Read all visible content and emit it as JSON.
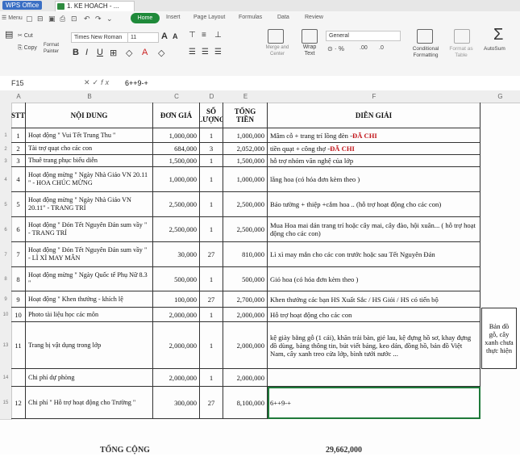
{
  "app": {
    "name": "WPS Office",
    "doc_tab": "1. KE HOACH - ..."
  },
  "tabs": [
    "Menu",
    "Home",
    "Insert",
    "Page Layout",
    "Formulas",
    "Data",
    "Review"
  ],
  "toolbar": {
    "cut": "Cut",
    "copy": "Copy",
    "format_painter": "Format Painter",
    "font_name": "Times New Roman",
    "font_size": "11",
    "merge": "Merge and Center",
    "wrap": "Wrap Text",
    "number_format": "General",
    "conditional": "Conditional Formatting",
    "format_table": "Format as Table",
    "autosum": "AutoSum"
  },
  "formula_bar": {
    "name_box": "F15",
    "formula": "6++9-+"
  },
  "columns": [
    "A",
    "B",
    "C",
    "D",
    "E",
    "F",
    "G"
  ],
  "headers": {
    "stt": "STT",
    "noi_dung": "NỘI DUNG",
    "don_gia": "ĐƠN GIÁ",
    "so_luong": "SỐ LƯỢNG",
    "tong_tien": "TỔNG TIỀN",
    "dien_giai": "DIỄN GIẢI"
  },
  "rows": [
    {
      "rownum": "1",
      "stt": "1",
      "noi_dung": "Hoạt động \" Vui Tết Trung Thu \"",
      "don_gia": "1,000,000",
      "so_luong": "1",
      "tong_tien": "1,000,000",
      "dien_giai": "Mâm cỗ + trang trí lồng đèn -",
      "dien_giai_red": "ĐÃ CHI"
    },
    {
      "rownum": "2",
      "stt": "2",
      "noi_dung": "Tài trợ quạt cho các con",
      "don_gia": "684,000",
      "so_luong": "3",
      "tong_tien": "2,052,000",
      "dien_giai": "tiền quạt + công thợ -",
      "dien_giai_red": "ĐÃ CHI"
    },
    {
      "rownum": "3",
      "stt": "3",
      "noi_dung": "Thuê trang phục biểu diễn",
      "don_gia": "1,500,000",
      "so_luong": "1",
      "tong_tien": "1,500,000",
      "dien_giai": "hỗ trợ nhóm văn nghệ của lớp",
      "dien_giai_red": ""
    },
    {
      "rownum": "4",
      "stt": "4",
      "noi_dung": "Hoạt động mừng \" Ngày Nhà Giáo VN 20.11 \" - HOA CHÚC MỪNG",
      "don_gia": "1,000,000",
      "so_luong": "1",
      "tong_tien": "1,000,000",
      "dien_giai": "lẵng hoa (có hóa đơn kèm theo )",
      "dien_giai_red": ""
    },
    {
      "rownum": "5",
      "stt": "5",
      "noi_dung": "Hoạt động mừng \" Ngày Nhà Giáo VN 20.11\" - TRANG TRÍ",
      "don_gia": "2,500,000",
      "so_luong": "1",
      "tong_tien": "2,500,000",
      "dien_giai": "Báo tường + thiệp +cắm hoa .. (hỗ trợ hoạt động cho các con)",
      "dien_giai_red": ""
    },
    {
      "rownum": "6",
      "stt": "6",
      "noi_dung": "Hoạt động \" Đón Tết Nguyên Đán sum vầy \" - TRANG TRÍ",
      "don_gia": "2,500,000",
      "so_luong": "1",
      "tong_tien": "2,500,000",
      "dien_giai": "Mua Hoa mai dán trang trí hoặc cây mai, cây đào, hội xuân... ( hỗ trợ hoạt động cho các con)",
      "dien_giai_red": ""
    },
    {
      "rownum": "7",
      "stt": "7",
      "noi_dung": "Hoạt động \" Đón Tết Nguyên Đán sum vầy \" - LÌ XÌ MAY MẮN",
      "don_gia": "30,000",
      "so_luong": "27",
      "tong_tien": "810,000",
      "dien_giai": "Lì xì may mắn cho các con trước hoặc sau Tết Nguyên Đán",
      "dien_giai_red": ""
    },
    {
      "rownum": "8",
      "stt": "8",
      "noi_dung": "Hoạt động mừng \" Ngày Quốc tế Phụ Nữ 8.3 \"",
      "don_gia": "500,000",
      "so_luong": "1",
      "tong_tien": "500,000",
      "dien_giai": "Giỏ hoa (có hóa đơn kèm theo )",
      "dien_giai_red": ""
    },
    {
      "rownum": "9",
      "stt": "9",
      "noi_dung": "Hoạt động \" Khen thưởng - khích lệ",
      "don_gia": "100,000",
      "so_luong": "27",
      "tong_tien": "2,700,000",
      "dien_giai": "Khen thưởng các bạn HS Xuất Sắc / HS Giỏi / HS có tiến bộ",
      "dien_giai_red": ""
    },
    {
      "rownum": "10",
      "stt": "10",
      "noi_dung": "Photo tài liệu học các môn",
      "don_gia": "2,000,000",
      "so_luong": "1",
      "tong_tien": "2,000,000",
      "dien_giai": "Hỗ trợ hoạt động cho các con",
      "dien_giai_red": ""
    },
    {
      "rownum": "13",
      "stt": "11",
      "noi_dung": "Trang bị vật dụng trong lớp",
      "don_gia": "2,000,000",
      "so_luong": "1",
      "tong_tien": "2,000,000",
      "dien_giai": "kệ giày bằng gỗ (1 cái), khăn trải bàn, giẻ lau, kệ đựng hồ sơ, khay đựng đồ dùng, bảng thông tin, bút viết bảng, keo dán, đồng hồ, bản đồ Việt Nam, cây xanh treo cửa lớp, bình tưới nước ...",
      "dien_giai_red": ""
    },
    {
      "rownum": "14",
      "stt": "",
      "noi_dung": "Chi phí dự phòng",
      "don_gia": "2,000,000",
      "so_luong": "1",
      "tong_tien": "2,000,000",
      "dien_giai": "",
      "dien_giai_red": ""
    },
    {
      "rownum": "15",
      "stt": "12",
      "noi_dung": "Chi phí \" Hỗ trợ hoạt động cho Trường \"",
      "don_gia": "300,000",
      "so_luong": "27",
      "tong_tien": "8,100,000",
      "dien_giai": "6++9-+",
      "dien_giai_red": ""
    }
  ],
  "side_note": "Bản đồ gỗ, cây xanh chưa thực hiện",
  "total": {
    "label": "TỔNG CỘNG",
    "value": "29,662,000"
  }
}
